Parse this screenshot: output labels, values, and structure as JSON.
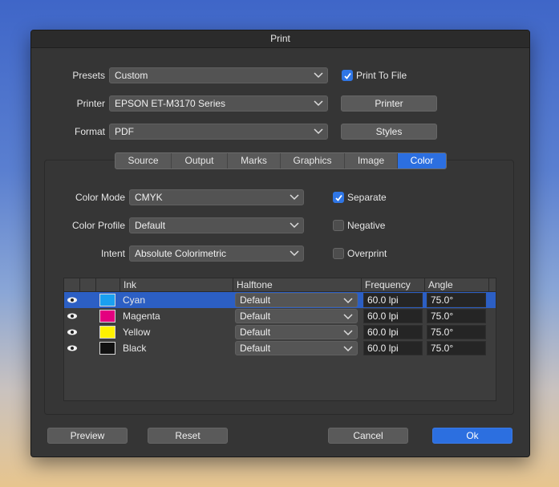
{
  "window": {
    "title": "Print"
  },
  "form": {
    "presets_label": "Presets",
    "presets_value": "Custom",
    "printer_label": "Printer",
    "printer_value": "EPSON ET-M3170 Series",
    "format_label": "Format",
    "format_value": "PDF",
    "print_to_file_label": "Print To File",
    "print_to_file_checked": true,
    "printer_button": "Printer",
    "styles_button": "Styles"
  },
  "tabs": [
    {
      "label": "Source",
      "active": false
    },
    {
      "label": "Output",
      "active": false
    },
    {
      "label": "Marks",
      "active": false
    },
    {
      "label": "Graphics",
      "active": false
    },
    {
      "label": "Image",
      "active": false
    },
    {
      "label": "Color",
      "active": true
    }
  ],
  "color": {
    "mode_label": "Color Mode",
    "mode_value": "CMYK",
    "profile_label": "Color Profile",
    "profile_value": "Default",
    "intent_label": "Intent",
    "intent_value": "Absolute Colorimetric",
    "separate_label": "Separate",
    "separate_checked": true,
    "negative_label": "Negative",
    "negative_checked": false,
    "overprint_label": "Overprint",
    "overprint_checked": false
  },
  "inks_table": {
    "headers": [
      "Ink",
      "Halftone",
      "Frequency",
      "Angle"
    ],
    "rows": [
      {
        "ink": "Cyan",
        "swatch": "#1aa0f0",
        "halftone": "Default",
        "frequency": "60.0 lpi",
        "angle": "75.0°",
        "selected": true
      },
      {
        "ink": "Magenta",
        "swatch": "#e4007f",
        "halftone": "Default",
        "frequency": "60.0 lpi",
        "angle": "75.0°",
        "selected": false
      },
      {
        "ink": "Yellow",
        "swatch": "#fff200",
        "halftone": "Default",
        "frequency": "60.0 lpi",
        "angle": "75.0°",
        "selected": false
      },
      {
        "ink": "Black",
        "swatch": "#111111",
        "halftone": "Default",
        "frequency": "60.0 lpi",
        "angle": "75.0°",
        "selected": false
      }
    ]
  },
  "footer": {
    "preview_button": "Preview",
    "reset_button": "Reset",
    "cancel_button": "Cancel",
    "ok_button": "Ok"
  },
  "colors": {
    "accent": "#2c6fe0",
    "window_bg": "#353535"
  }
}
